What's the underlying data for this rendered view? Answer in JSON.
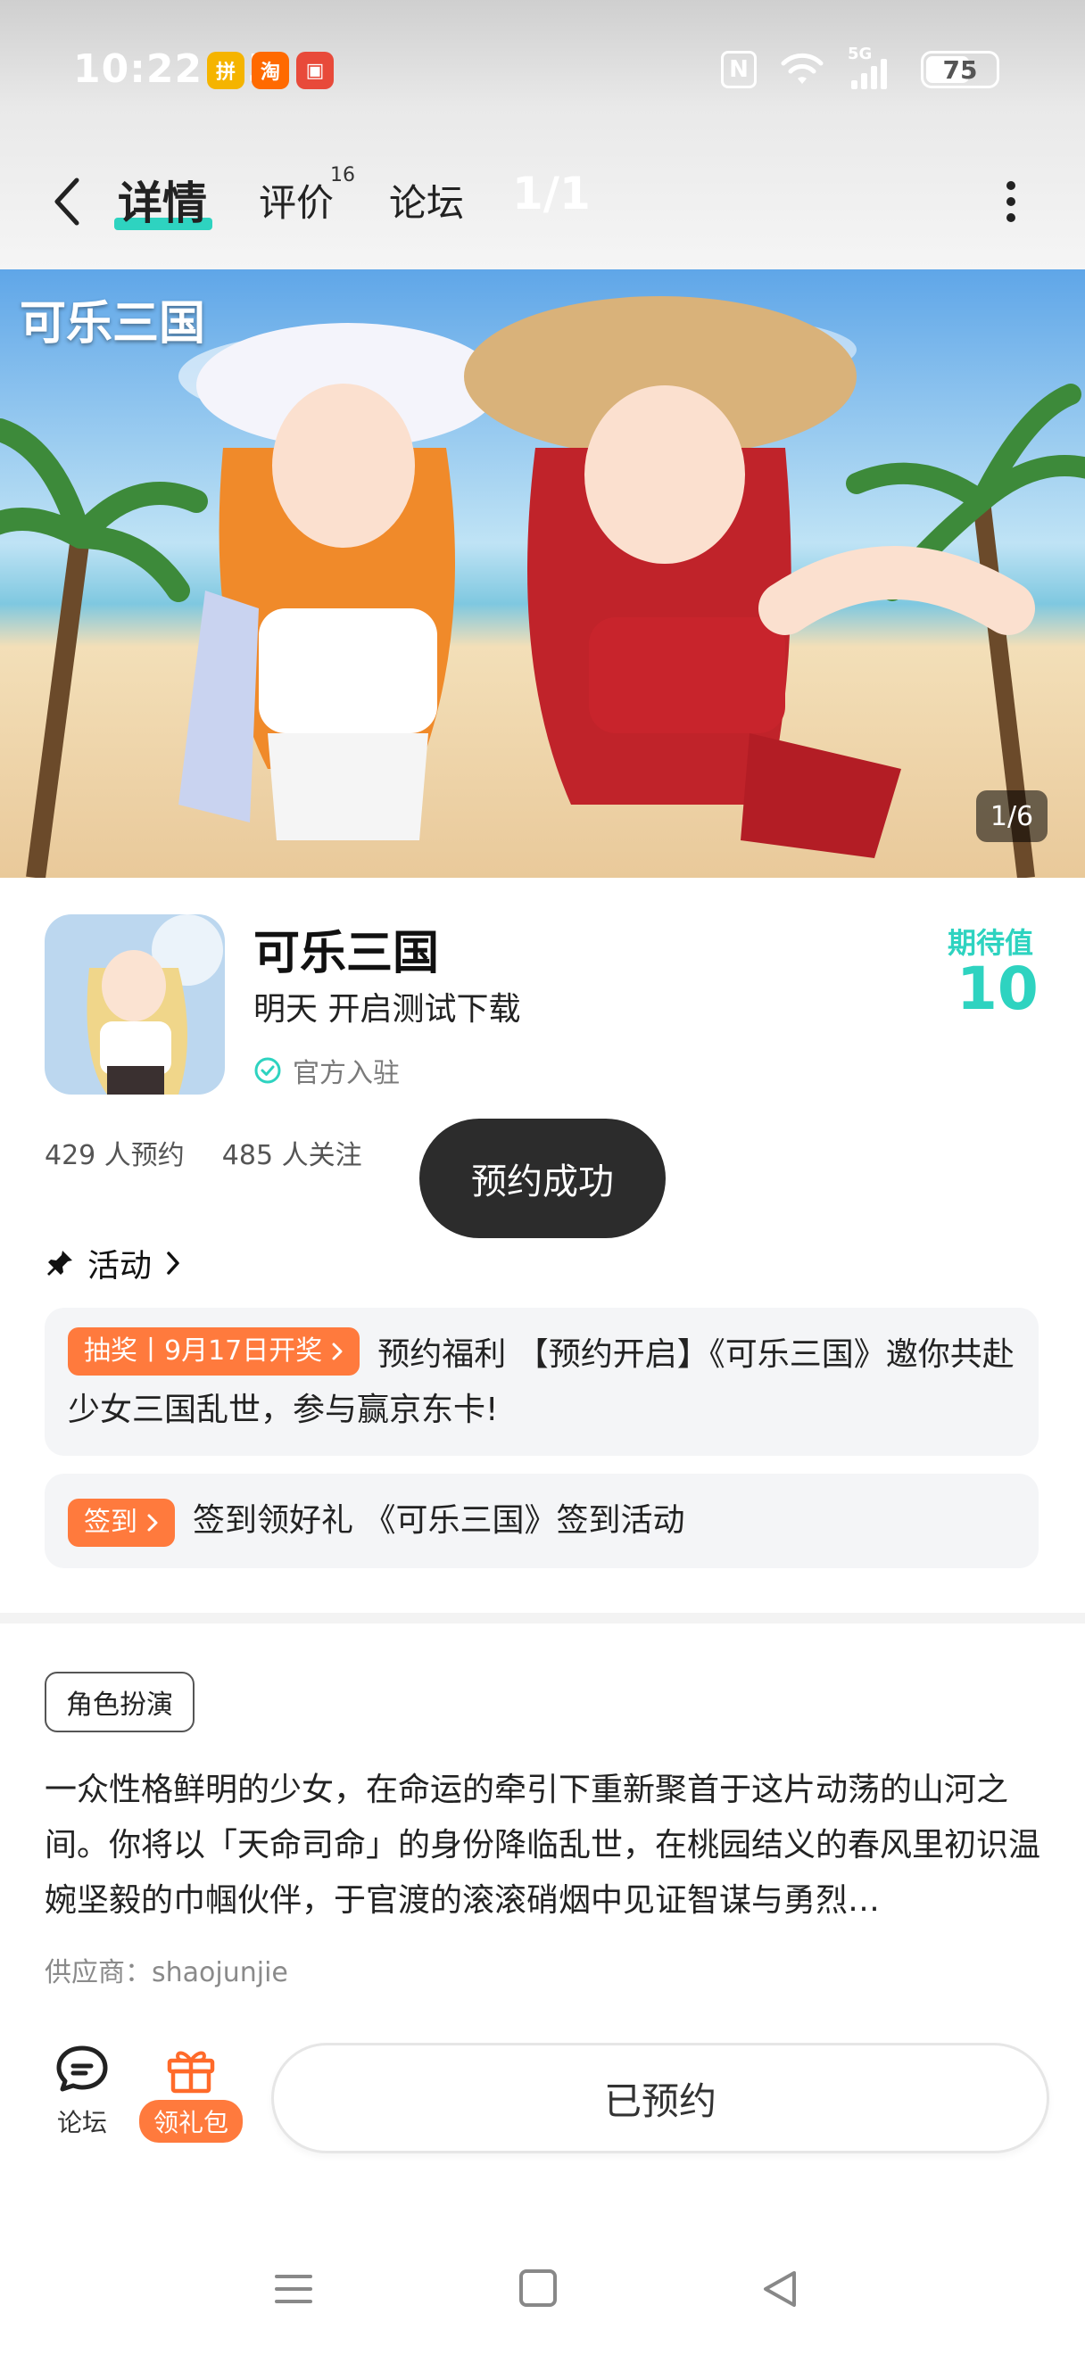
{
  "status_bar": {
    "time": "10:22:25",
    "app_icons": [
      {
        "name": "pinduoduo-icon",
        "label": "拼",
        "color": "#f5b400"
      },
      {
        "name": "taobao-icon",
        "label": "淘",
        "color": "#ff6a00"
      },
      {
        "name": "calendar-app-icon",
        "label": "▣",
        "color": "#e84a3a"
      }
    ],
    "nfc_label": "N",
    "network_label": "5G",
    "battery": "75"
  },
  "nav": {
    "tabs": [
      {
        "label": "详情",
        "active": true
      },
      {
        "label": "评价",
        "badge": "16"
      },
      {
        "label": "论坛"
      }
    ],
    "page_indicator": "1/1"
  },
  "banner": {
    "logo_text": "可乐三国",
    "counter": "1/6"
  },
  "game": {
    "title": "可乐三国",
    "status": "明天 开启测试下载",
    "official": "官方入驻",
    "expect_label": "期待值",
    "expect_value": "10",
    "stats": {
      "reservations": "429 人预约",
      "followers": "485 人关注"
    }
  },
  "toast": "预约成功",
  "activities": {
    "title": "活动",
    "items": [
      {
        "tag": "抽奖丨9月17日开奖",
        "text": "预约福利 【预约开启】《可乐三国》邀你共赴少女三国乱世，参与赢京东卡!"
      },
      {
        "tag": "签到",
        "text": "签到领好礼 《可乐三国》签到活动"
      }
    ]
  },
  "genre_tag": "角色扮演",
  "description": "一众性格鲜明的少女，在命运的牵引下重新聚首于这片动荡的山河之间。你将以「天命司命」的身份降临乱世，在桃园结义的春风里初识温婉坚毅的巾帼伙伴，于官渡的滚滚硝烟中见证智谋与勇烈…",
  "supplier": "供应商：shaojunjie",
  "bottom_bar": {
    "forum_label": "论坛",
    "gift_label": "领礼包",
    "reserved_label": "已预约"
  },
  "colors": {
    "accent": "#2ed3c0",
    "orange": "#ff7a3d",
    "toast_bg": "#2c2c2c"
  }
}
